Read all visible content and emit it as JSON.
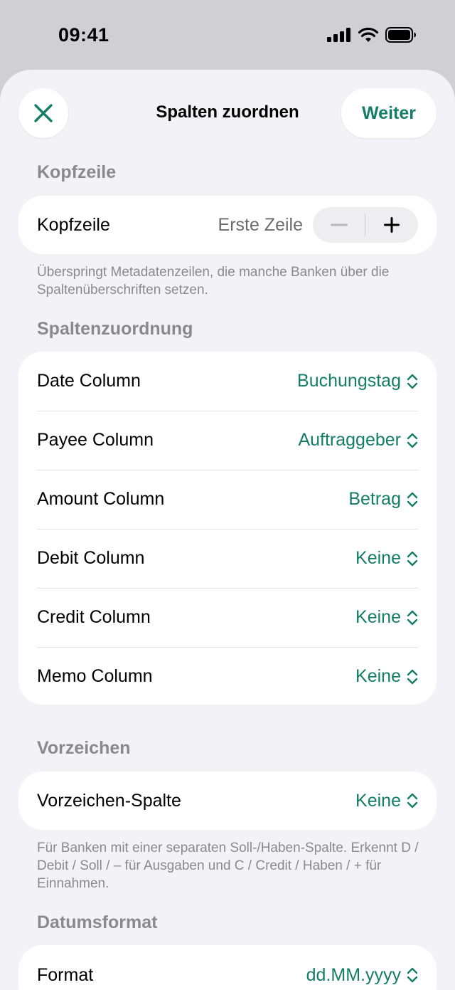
{
  "status_bar": {
    "time": "09:41",
    "icons": [
      "cellular-signal-icon",
      "wifi-icon",
      "battery-icon"
    ]
  },
  "nav": {
    "title": "Spalten zuordnen",
    "close_icon": "close-icon",
    "next_label": "Weiter"
  },
  "colors": {
    "accent": "#147d68",
    "background": "#f2f2f7",
    "card": "#ffffff",
    "secondary_text": "#8a8a8e"
  },
  "header_section": {
    "title": "Kopfzeile",
    "row_label": "Kopfzeile",
    "row_value": "Erste Zeile",
    "footnote": "Überspringt Metadatenzeilen, die manche Banken über die Spaltenüberschriften setzen."
  },
  "mapping_section": {
    "title": "Spaltenzuordnung",
    "rows": [
      {
        "label": "Date Column",
        "value": "Buchungstag"
      },
      {
        "label": "Payee Column",
        "value": "Auftraggeber"
      },
      {
        "label": "Amount Column",
        "value": "Betrag"
      },
      {
        "label": "Debit Column",
        "value": "Keine"
      },
      {
        "label": "Credit Column",
        "value": "Keine"
      },
      {
        "label": "Memo Column",
        "value": "Keine"
      }
    ]
  },
  "sign_section": {
    "title": "Vorzeichen",
    "row_label": "Vorzeichen-Spalte",
    "row_value": "Keine",
    "footnote": "Für Banken mit einer separaten Soll-/Haben-Spalte. Erkennt D / Debit / Soll / – für Ausgaben und C / Credit / Haben / + für Einnahmen."
  },
  "date_section": {
    "title": "Datumsformat",
    "row_label": "Format",
    "row_value": "dd.MM.yyyy"
  }
}
